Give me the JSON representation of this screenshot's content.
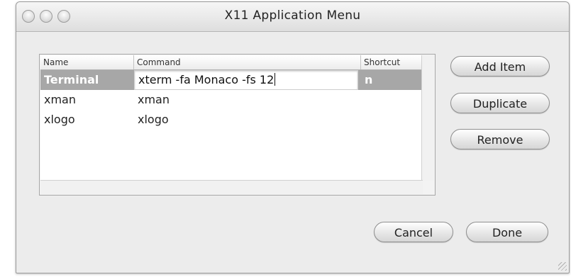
{
  "window": {
    "title": "X11 Application Menu"
  },
  "table": {
    "columns": [
      "Name",
      "Command",
      "Shortcut"
    ],
    "rows": [
      {
        "name": "Terminal",
        "command": "xterm -fa Monaco -fs 12",
        "shortcut": "n",
        "selected": true,
        "editing": true
      },
      {
        "name": "xman",
        "command": "xman",
        "shortcut": "",
        "selected": false
      },
      {
        "name": "xlogo",
        "command": "xlogo",
        "shortcut": "",
        "selected": false
      }
    ]
  },
  "buttons": {
    "add_item": "Add Item",
    "duplicate": "Duplicate",
    "remove": "Remove",
    "cancel": "Cancel",
    "done": "Done"
  },
  "colors": {
    "selection": "#a7a7a7",
    "window_bg": "#ececec"
  }
}
